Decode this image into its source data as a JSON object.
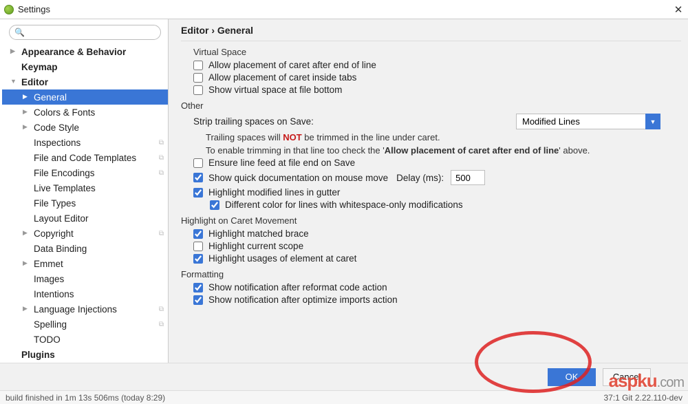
{
  "window": {
    "title": "Settings",
    "close": "✕"
  },
  "search": {
    "placeholder": ""
  },
  "tree": {
    "items": [
      {
        "label": "Appearance & Behavior",
        "bold": true,
        "arrow": "right",
        "indent": 0
      },
      {
        "label": "Keymap",
        "bold": true,
        "arrow": "empty",
        "indent": 0
      },
      {
        "label": "Editor",
        "bold": true,
        "arrow": "down",
        "indent": 0
      },
      {
        "label": "General",
        "bold": false,
        "arrow": "right",
        "indent": 1,
        "selected": true
      },
      {
        "label": "Colors & Fonts",
        "bold": false,
        "arrow": "right",
        "indent": 1
      },
      {
        "label": "Code Style",
        "bold": false,
        "arrow": "right",
        "indent": 1
      },
      {
        "label": "Inspections",
        "bold": false,
        "arrow": "empty",
        "indent": 1,
        "share": true
      },
      {
        "label": "File and Code Templates",
        "bold": false,
        "arrow": "empty",
        "indent": 1,
        "share": true
      },
      {
        "label": "File Encodings",
        "bold": false,
        "arrow": "empty",
        "indent": 1,
        "share": true
      },
      {
        "label": "Live Templates",
        "bold": false,
        "arrow": "empty",
        "indent": 1
      },
      {
        "label": "File Types",
        "bold": false,
        "arrow": "empty",
        "indent": 1
      },
      {
        "label": "Layout Editor",
        "bold": false,
        "arrow": "empty",
        "indent": 1
      },
      {
        "label": "Copyright",
        "bold": false,
        "arrow": "right",
        "indent": 1,
        "share": true
      },
      {
        "label": "Data Binding",
        "bold": false,
        "arrow": "empty",
        "indent": 1
      },
      {
        "label": "Emmet",
        "bold": false,
        "arrow": "right",
        "indent": 1
      },
      {
        "label": "Images",
        "bold": false,
        "arrow": "empty",
        "indent": 1
      },
      {
        "label": "Intentions",
        "bold": false,
        "arrow": "empty",
        "indent": 1
      },
      {
        "label": "Language Injections",
        "bold": false,
        "arrow": "right",
        "indent": 1,
        "share": true
      },
      {
        "label": "Spelling",
        "bold": false,
        "arrow": "empty",
        "indent": 1,
        "share": true
      },
      {
        "label": "TODO",
        "bold": false,
        "arrow": "empty",
        "indent": 1
      },
      {
        "label": "Plugins",
        "bold": true,
        "arrow": "empty",
        "indent": 0
      }
    ]
  },
  "breadcrumb": {
    "path": "Editor › General"
  },
  "virtual_space": {
    "title": "Virtual Space",
    "caret_end": {
      "label": "Allow placement of caret after end of line",
      "checked": false
    },
    "caret_tabs": {
      "label": "Allow placement of caret inside tabs",
      "checked": false
    },
    "show_bottom": {
      "label": "Show virtual space at file bottom",
      "checked": false
    }
  },
  "other": {
    "title": "Other",
    "strip_label": "Strip trailing spaces on Save:",
    "strip_mode": "Modified Lines",
    "note_prefix": "Trailing spaces will ",
    "note_not": "NOT",
    "note_suffix": " be trimmed in the line under caret.",
    "note_enable_prefix": "To enable trimming in that line too check the '",
    "note_enable_bold": "Allow placement of caret after end of line",
    "note_enable_suffix": "' above.",
    "ensure_lf": {
      "label": "Ensure line feed at file end on Save",
      "checked": false
    },
    "quick_doc": {
      "label": "Show quick documentation on mouse move",
      "checked": true,
      "delay_label": "Delay (ms):",
      "delay_value": "500"
    },
    "highlight_mod": {
      "label": "Highlight modified lines in gutter",
      "checked": true
    },
    "diff_color": {
      "label": "Different color for lines with whitespace-only modifications",
      "checked": true
    }
  },
  "caret_move": {
    "title": "Highlight on Caret Movement",
    "matched_brace": {
      "label": "Highlight matched brace",
      "checked": true
    },
    "current_scope": {
      "label": "Highlight current scope",
      "checked": false
    },
    "usages": {
      "label": "Highlight usages of element at caret",
      "checked": true
    }
  },
  "formatting": {
    "title": "Formatting",
    "reformat": {
      "label": "Show notification after reformat code action",
      "checked": true
    },
    "optimize": {
      "label": "Show notification after optimize imports action",
      "checked": true
    }
  },
  "buttons": {
    "ok": "OK",
    "cancel": "Cancel"
  },
  "status": {
    "left": "build finished in 1m 13s 506ms (today 8:29)",
    "right": "37:1  Git 2.22.110-dev"
  },
  "watermark": {
    "red": "aspku",
    "grey": ".com"
  }
}
